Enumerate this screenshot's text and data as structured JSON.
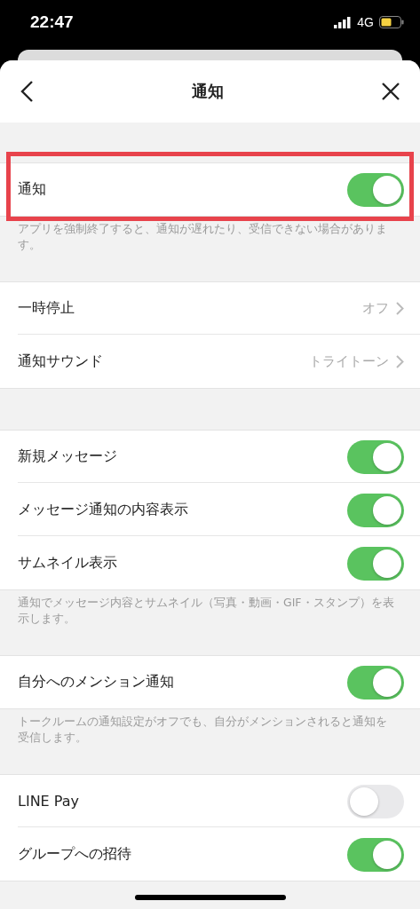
{
  "status_bar": {
    "time": "22:47",
    "network": "4G"
  },
  "header": {
    "title": "通知"
  },
  "sections": [
    {
      "rows": [
        {
          "kind": "toggle",
          "label": "通知",
          "on": true,
          "highlighted": true
        }
      ],
      "footnote": "アプリを強制終了すると、通知が遅れたり、受信できない場合があります。"
    },
    {
      "rows": [
        {
          "kind": "link",
          "label": "一時停止",
          "value": "オフ",
          "highlighted": false
        },
        {
          "kind": "link",
          "label": "通知サウンド",
          "value": "トライトーン",
          "highlighted": false
        }
      ]
    },
    {
      "rows": [
        {
          "kind": "toggle",
          "label": "新規メッセージ",
          "on": true,
          "highlighted": false
        },
        {
          "kind": "toggle",
          "label": "メッセージ通知の内容表示",
          "on": true,
          "highlighted": false
        },
        {
          "kind": "toggle",
          "label": "サムネイル表示",
          "on": true,
          "highlighted": false
        }
      ],
      "footnote": "通知でメッセージ内容とサムネイル（写真・動画・GIF・スタンプ）を表示します。"
    },
    {
      "rows": [
        {
          "kind": "toggle",
          "label": "自分へのメンション通知",
          "on": true,
          "highlighted": false
        }
      ],
      "footnote": "トークルームの通知設定がオフでも、自分がメンションされると通知を受信します。"
    },
    {
      "rows": [
        {
          "kind": "toggle",
          "label": "LINE Pay",
          "on": false,
          "highlighted": false
        },
        {
          "kind": "toggle",
          "label": "グループへの招待",
          "on": true,
          "highlighted": false
        }
      ]
    }
  ]
}
